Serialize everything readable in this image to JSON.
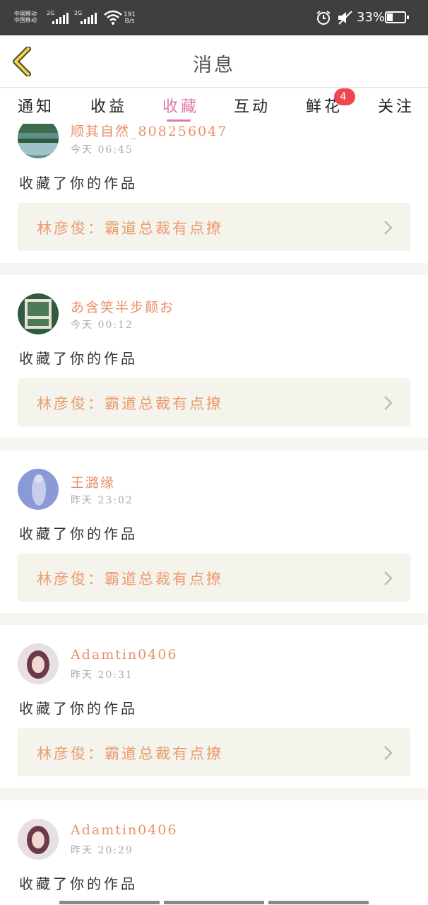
{
  "status_bar": {
    "carrier_line1": "中国移动",
    "carrier_line2": "中国移动",
    "network1": "2G",
    "network2": "2G",
    "net_speed_value": "191",
    "net_speed_unit": "B/s",
    "battery_percent": "33%",
    "battery_level": 0.33
  },
  "header": {
    "title": "消息"
  },
  "tabs": [
    {
      "label": "通知"
    },
    {
      "label": "收益"
    },
    {
      "label": "收藏",
      "active": true
    },
    {
      "label": "互动"
    },
    {
      "label": "鲜花",
      "badge": "4"
    },
    {
      "label": "关注"
    }
  ],
  "colors": {
    "accent": "#e07aa8",
    "username": "#e9916b",
    "work_title": "#eb9b6d",
    "badge": "#f0474f"
  },
  "feed": [
    {
      "user": "顺其自然_808256047",
      "time": "今天 06:45",
      "action": "收藏了你的作品",
      "work": "林彦俊：霸道总裁有点撩"
    },
    {
      "user": "あ含笑半步颠お",
      "time": "今天 00:12",
      "action": "收藏了你的作品",
      "work": "林彦俊：霸道总裁有点撩"
    },
    {
      "user": "王潞缘",
      "time": "昨天 23:02",
      "action": "收藏了你的作品",
      "work": "林彦俊：霸道总裁有点撩"
    },
    {
      "user": "Adamtin0406",
      "time": "昨天 20:31",
      "action": "收藏了你的作品",
      "work": "林彦俊：霸道总裁有点撩"
    },
    {
      "user": "Adamtin0406",
      "time": "昨天 20:29",
      "action": "收藏了你的作品"
    }
  ]
}
